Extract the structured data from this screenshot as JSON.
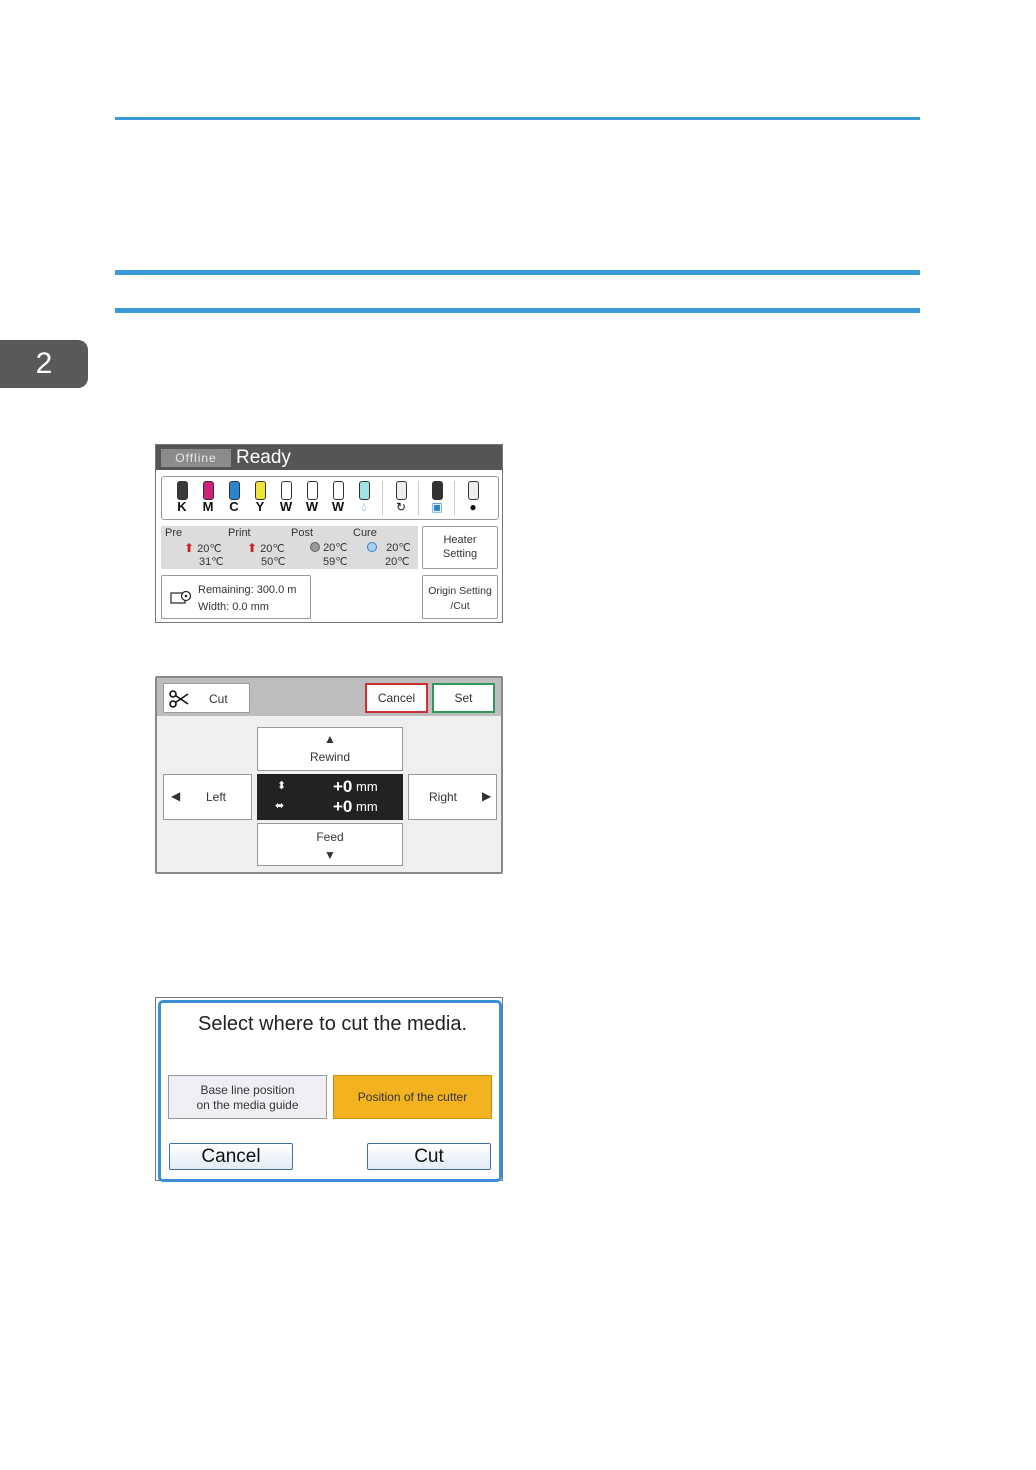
{
  "chapter_number": "2",
  "screen1": {
    "status_chip": "Offline",
    "status_text": "Ready",
    "inks": [
      {
        "label": "K",
        "color": "#3a3a3a"
      },
      {
        "label": "M",
        "color": "#d0227a"
      },
      {
        "label": "C",
        "color": "#2a86d0"
      },
      {
        "label": "Y",
        "color": "#eee43a"
      },
      {
        "label": "W",
        "color": "#ffffff"
      },
      {
        "label": "W",
        "color": "#ffffff"
      },
      {
        "label": "W",
        "color": "#ffffff"
      },
      {
        "label": "drop",
        "color": "#9fe3e3"
      }
    ],
    "heaters": [
      {
        "name": "Pre",
        "set": "20℃",
        "current": "31℃",
        "state": "heating"
      },
      {
        "name": "Print",
        "set": "20℃",
        "current": "50℃",
        "state": "heating"
      },
      {
        "name": "Post",
        "set": "20℃",
        "current": "59℃",
        "state": "idle"
      },
      {
        "name": "Cure",
        "set": "20℃",
        "current": "20℃",
        "state": "ready"
      }
    ],
    "heater_button": {
      "line1": "Heater",
      "line2": "Setting"
    },
    "remaining": "Remaining: 300.0 m",
    "width": "Width: 0.0 mm",
    "origin_button": {
      "line1": "Origin Setting",
      "line2": "/Cut"
    }
  },
  "screen2": {
    "cut_label": "Cut",
    "cancel_label": "Cancel",
    "set_label": "Set",
    "rewind_label": "Rewind",
    "left_label": "Left",
    "right_label": "Right",
    "feed_label": "Feed",
    "vertical_offset": "+0",
    "horizontal_offset": "+0",
    "unit": "mm"
  },
  "screen3": {
    "prompt": "Select where to cut the media.",
    "option1_line1": "Base line position",
    "option1_line2": "on the media guide",
    "option2": "Position of the cutter",
    "cancel_label": "Cancel",
    "cut_label": "Cut"
  }
}
